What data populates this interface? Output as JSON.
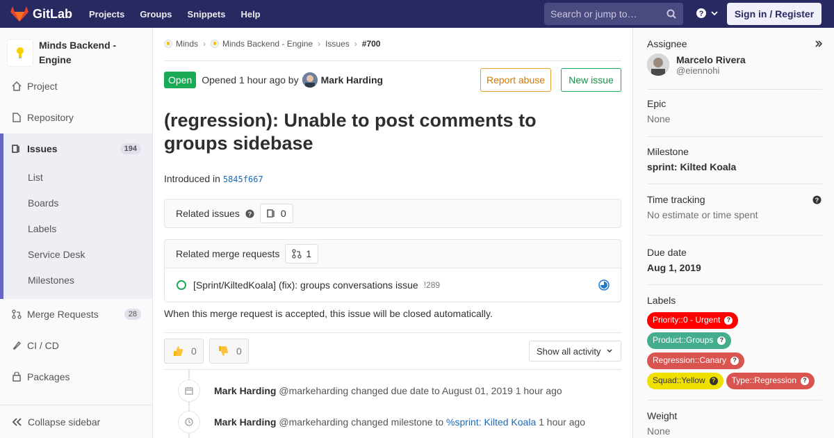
{
  "navbar": {
    "brand": "GitLab",
    "links": [
      "Projects",
      "Groups",
      "Snippets",
      "Help"
    ],
    "search_placeholder": "Search or jump to…",
    "signin_label": "Sign in / Register"
  },
  "sidebar": {
    "project_name": "Minds Backend - Engine",
    "items": [
      {
        "label": "Project"
      },
      {
        "label": "Repository"
      },
      {
        "label": "Issues",
        "count": "194"
      },
      {
        "label": "Merge Requests",
        "count": "28"
      },
      {
        "label": "CI / CD"
      },
      {
        "label": "Packages"
      }
    ],
    "issues_sub": [
      "List",
      "Boards",
      "Labels",
      "Service Desk",
      "Milestones"
    ],
    "collapse_label": "Collapse sidebar"
  },
  "breadcrumb": [
    "Minds",
    "Minds Backend - Engine",
    "Issues",
    "#700"
  ],
  "issue": {
    "status": "Open",
    "opened_text": "Opened 1 hour ago by",
    "author": "Mark Harding",
    "report_label": "Report abuse",
    "new_issue_label": "New issue",
    "title": "(regression): Unable to post comments to groups sidebase",
    "intro_prefix": "Introduced in",
    "intro_sha": "5845f667"
  },
  "related_issues": {
    "label": "Related issues",
    "count": "0"
  },
  "related_mrs": {
    "label": "Related merge requests",
    "count": "1",
    "items": [
      {
        "title": "[Sprint/KiltedKoala] (fix): groups conversations issue",
        "ref": "!289"
      }
    ]
  },
  "accept_note": "When this merge request is accepted, this issue will be closed automatically.",
  "awards": {
    "thumbs_up": "0",
    "thumbs_down": "0"
  },
  "activity_filter": "Show all activity",
  "timeline": [
    {
      "author": "Mark Harding",
      "handle": "@markeharding",
      "action": "changed due date to August 01, 2019",
      "link": "",
      "time": "1 hour ago"
    },
    {
      "author": "Mark Harding",
      "handle": "@markeharding",
      "action": "changed milestone to",
      "link": "%sprint: Kilted Koala",
      "time": "1 hour ago"
    }
  ],
  "right_sidebar": {
    "assignee_title": "Assignee",
    "assignee_name": "Marcelo Rivera",
    "assignee_handle": "@eiennohi",
    "epic_title": "Epic",
    "epic_value": "None",
    "milestone_title": "Milestone",
    "milestone_value": "sprint: Kilted Koala",
    "time_title": "Time tracking",
    "time_value": "No estimate or time spent",
    "due_title": "Due date",
    "due_value": "Aug 1, 2019",
    "labels_title": "Labels",
    "labels": [
      {
        "text": "Priority::0 - Urgent",
        "color": "#ff0000",
        "fg": "#ffffff"
      },
      {
        "text": "Product::Groups",
        "color": "#44ad8e",
        "fg": "#ffffff"
      },
      {
        "text": "Regression::Canary",
        "color": "#d9534f",
        "fg": "#ffffff"
      },
      {
        "text": "Squad::Yellow",
        "color": "#f0e000",
        "fg": "#333333"
      },
      {
        "text": "Type::Regression",
        "color": "#d9534f",
        "fg": "#ffffff"
      }
    ],
    "weight_title": "Weight",
    "weight_value": "None"
  }
}
